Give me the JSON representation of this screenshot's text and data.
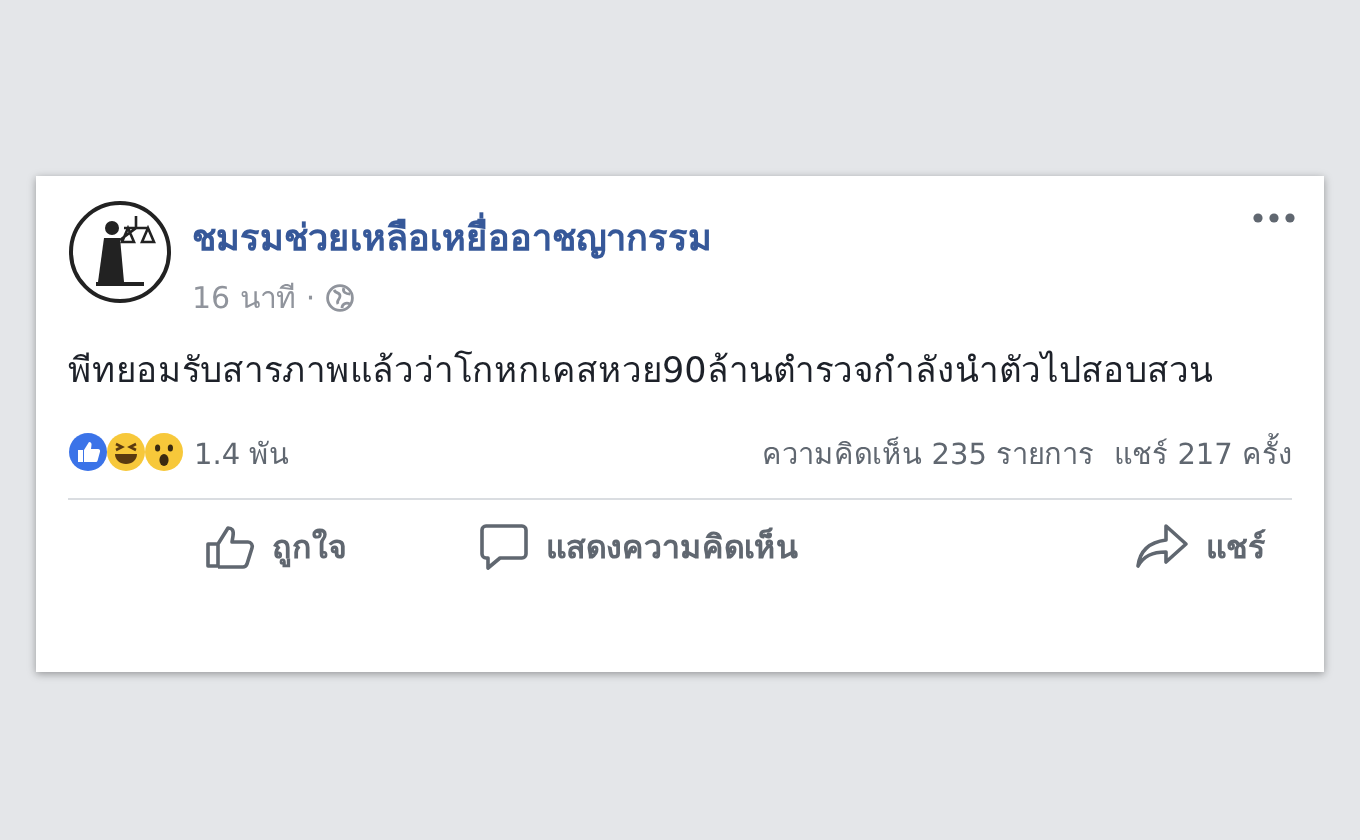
{
  "post": {
    "author": "ชมรมช่วยเหลือเหยื่ออาชญากรรม",
    "time": "16 นาที",
    "separator": "·",
    "text": "พีทยอมรับสารภาพแล้วว่าโกหกเคสหวย90ล้านตำรวจกำลังนำตัวไปสอบสวน",
    "reactions": [
      {
        "kind": "like"
      },
      {
        "kind": "haha"
      },
      {
        "kind": "wow"
      }
    ],
    "reaction_count": "1.4 พัน",
    "comments": "ความคิดเห็น 235 รายการ",
    "shares": "แชร์ 217 ครั้ง",
    "actions": [
      {
        "kind": "like",
        "label": "ถูกใจ"
      },
      {
        "kind": "comment",
        "label": "แสดงความคิดเห็น"
      },
      {
        "kind": "share",
        "label": "แชร์"
      }
    ]
  }
}
